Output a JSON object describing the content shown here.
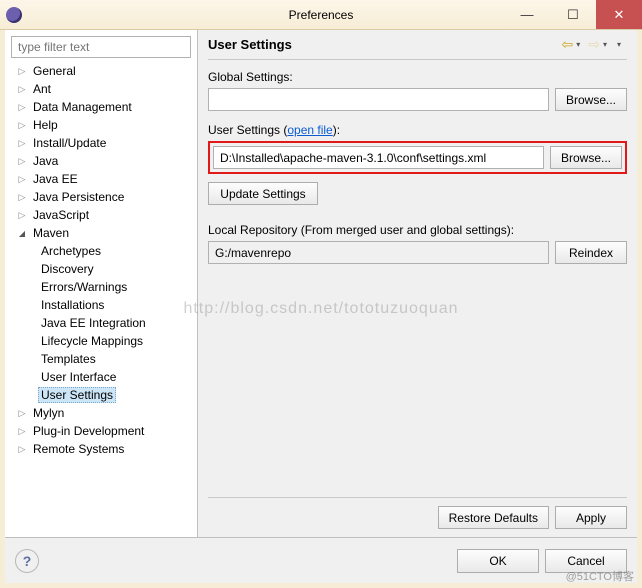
{
  "window": {
    "title": "Preferences",
    "min_tooltip": "Minimize",
    "max_tooltip": "Maximize",
    "close_tooltip": "Close"
  },
  "filter": {
    "placeholder": "type filter text"
  },
  "tree": {
    "items": [
      {
        "label": "General",
        "depth": 0,
        "state": "closed"
      },
      {
        "label": "Ant",
        "depth": 0,
        "state": "closed"
      },
      {
        "label": "Data Management",
        "depth": 0,
        "state": "closed"
      },
      {
        "label": "Help",
        "depth": 0,
        "state": "closed"
      },
      {
        "label": "Install/Update",
        "depth": 0,
        "state": "closed"
      },
      {
        "label": "Java",
        "depth": 0,
        "state": "closed"
      },
      {
        "label": "Java EE",
        "depth": 0,
        "state": "closed"
      },
      {
        "label": "Java Persistence",
        "depth": 0,
        "state": "closed"
      },
      {
        "label": "JavaScript",
        "depth": 0,
        "state": "closed"
      },
      {
        "label": "Maven",
        "depth": 0,
        "state": "open"
      },
      {
        "label": "Archetypes",
        "depth": 1
      },
      {
        "label": "Discovery",
        "depth": 1
      },
      {
        "label": "Errors/Warnings",
        "depth": 1
      },
      {
        "label": "Installations",
        "depth": 1
      },
      {
        "label": "Java EE Integration",
        "depth": 1
      },
      {
        "label": "Lifecycle Mappings",
        "depth": 1
      },
      {
        "label": "Templates",
        "depth": 1
      },
      {
        "label": "User Interface",
        "depth": 1
      },
      {
        "label": "User Settings",
        "depth": 1,
        "selected": true
      },
      {
        "label": "Mylyn",
        "depth": 0,
        "state": "closed"
      },
      {
        "label": "Plug-in Development",
        "depth": 0,
        "state": "closed"
      },
      {
        "label": "Remote Systems",
        "depth": 0,
        "state": "closed"
      }
    ]
  },
  "panel": {
    "heading": "User Settings",
    "global_label": "Global Settings:",
    "global_value": "",
    "browse": "Browse...",
    "user_label_prefix": "User Settings (",
    "user_label_link": "open file",
    "user_label_suffix": "):",
    "user_value": "D:\\Installed\\apache-maven-3.1.0\\conf\\settings.xml",
    "update": "Update Settings",
    "repo_label": "Local Repository (From merged user and global settings):",
    "repo_value": "G:/mavenrepo",
    "reindex": "Reindex",
    "restore": "Restore Defaults",
    "apply": "Apply"
  },
  "dialog": {
    "ok": "OK",
    "cancel": "Cancel",
    "help": "?"
  },
  "watermark": "http://blog.csdn.net/tototuzuoquan",
  "corner": "@51CTO博客"
}
